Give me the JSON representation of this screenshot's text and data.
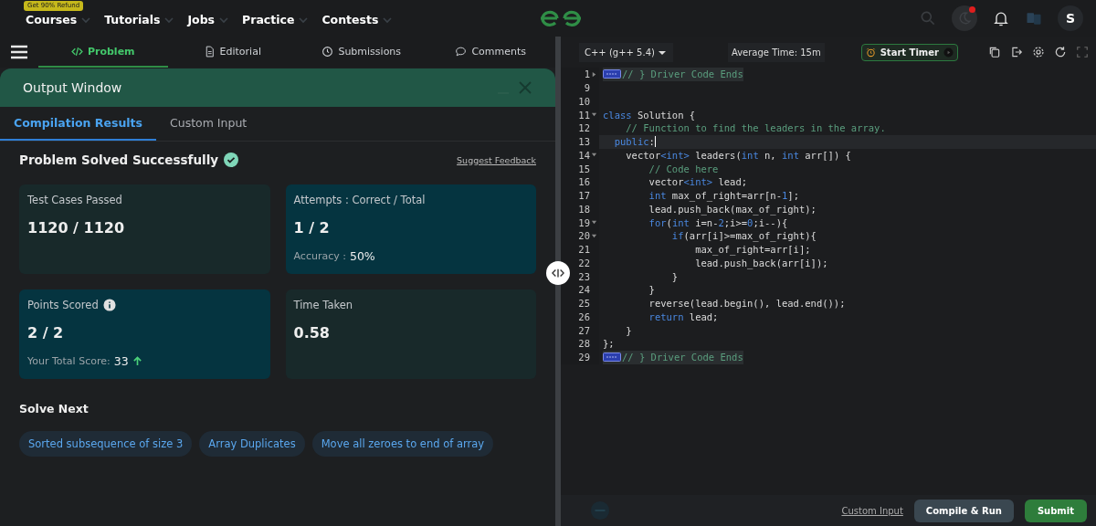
{
  "nav": {
    "badge": "Get 90% Refund",
    "items": [
      {
        "label": "Courses"
      },
      {
        "label": "Tutorials"
      },
      {
        "label": "Jobs"
      },
      {
        "label": "Practice"
      },
      {
        "label": "Contests"
      }
    ],
    "notification_dot": true,
    "avatar": "S"
  },
  "problem_tabs": [
    {
      "label": "Problem",
      "selected": true
    },
    {
      "label": "Editorial",
      "selected": false
    },
    {
      "label": "Submissions",
      "selected": false
    },
    {
      "label": "Comments",
      "selected": false
    }
  ],
  "output_window": {
    "title": "Output Window",
    "tabs": [
      {
        "label": "Compilation Results",
        "selected": true
      },
      {
        "label": "Custom Input",
        "selected": false
      }
    ],
    "status": "Problem Solved Successfully",
    "feedback_link": "Suggest Feedback",
    "cards": [
      {
        "title": "Test Cases Passed",
        "value": "1120 / 1120",
        "info": false,
        "rising": false,
        "color": "#18292a"
      },
      {
        "title": "Attempts : Correct / Total",
        "value": "1 / 2",
        "note_label": "Accuracy :",
        "note_value": "50%",
        "info": false,
        "rising": false,
        "color": "#053440"
      },
      {
        "title": "Points Scored",
        "value": "2 / 2",
        "info": true,
        "note_label": "Your Total Score:",
        "note_value": "33",
        "rising": true,
        "color": "#053440"
      },
      {
        "title": "Time Taken",
        "value": "0.58",
        "info": false,
        "rising": false,
        "color": "#18292a"
      }
    ],
    "solve_next_title": "Solve Next",
    "solve_next": [
      "Sorted subsequence of size 3",
      "Array Duplicates",
      "Move all zeroes to end of array"
    ]
  },
  "editor": {
    "language": "C++ (g++ 5.4)",
    "average_time": "Average Time: 15m",
    "timer_button": "Start Timer",
    "lines": [
      {
        "number": "1",
        "foldable": true,
        "collapsed": true,
        "badge": true,
        "current": false,
        "tokens": [
          {
            "kind": "cm",
            "text": "// } Driver Code Ends"
          }
        ]
      },
      {
        "number": "9",
        "foldable": false,
        "badge": false,
        "current": false
      },
      {
        "number": "10",
        "foldable": false,
        "badge": false,
        "current": false
      },
      {
        "number": "11",
        "foldable": true,
        "collapsed": false,
        "badge": false,
        "current": false,
        "tokens": [
          {
            "kind": "kw",
            "text": "class"
          },
          {
            "kind": "tx",
            "text": " Solution {"
          }
        ]
      },
      {
        "number": "12",
        "foldable": false,
        "badge": false,
        "current": false,
        "tokens": [
          {
            "kind": "cm",
            "text": "    // Function to find the leaders in the array."
          }
        ]
      },
      {
        "number": "13",
        "foldable": false,
        "badge": false,
        "current": true,
        "tokens": [
          {
            "kind": "kw",
            "text": "  public"
          },
          {
            "kind": "tx",
            "text": ":"
          }
        ]
      },
      {
        "number": "14",
        "foldable": true,
        "collapsed": false,
        "badge": false,
        "current": false,
        "tokens": [
          {
            "kind": "tx",
            "text": "    vector"
          },
          {
            "kind": "kw",
            "text": "<int>"
          },
          {
            "kind": "tx",
            "text": " leaders("
          },
          {
            "kind": "kw",
            "text": "int"
          },
          {
            "kind": "tx",
            "text": " n, "
          },
          {
            "kind": "kw",
            "text": "int"
          },
          {
            "kind": "tx",
            "text": " arr[]) {"
          }
        ]
      },
      {
        "number": "15",
        "foldable": false,
        "badge": false,
        "current": false,
        "tokens": [
          {
            "kind": "cm",
            "text": "        // Code here"
          }
        ]
      },
      {
        "number": "16",
        "foldable": false,
        "badge": false,
        "current": false,
        "tokens": [
          {
            "kind": "tx",
            "text": "        vector"
          },
          {
            "kind": "kw",
            "text": "<int>"
          },
          {
            "kind": "tx",
            "text": " lead;"
          }
        ]
      },
      {
        "number": "17",
        "foldable": false,
        "badge": false,
        "current": false,
        "tokens": [
          {
            "kind": "kw",
            "text": "        int"
          },
          {
            "kind": "tx",
            "text": " max_of_right=arr[n-"
          },
          {
            "kind": "num",
            "text": "1"
          },
          {
            "kind": "tx",
            "text": "];"
          }
        ]
      },
      {
        "number": "18",
        "foldable": false,
        "badge": false,
        "current": false,
        "tokens": [
          {
            "kind": "tx",
            "text": "        lead.push_back(max_of_right);"
          }
        ]
      },
      {
        "number": "19",
        "foldable": true,
        "collapsed": false,
        "badge": false,
        "current": false,
        "tokens": [
          {
            "kind": "kw",
            "text": "        for"
          },
          {
            "kind": "tx",
            "text": "("
          },
          {
            "kind": "kw",
            "text": "int"
          },
          {
            "kind": "tx",
            "text": " i=n-"
          },
          {
            "kind": "num",
            "text": "2"
          },
          {
            "kind": "tx",
            "text": ";i>="
          },
          {
            "kind": "num",
            "text": "0"
          },
          {
            "kind": "tx",
            "text": ";i--){"
          }
        ]
      },
      {
        "number": "20",
        "foldable": true,
        "collapsed": false,
        "badge": false,
        "current": false,
        "tokens": [
          {
            "kind": "kw",
            "text": "            if"
          },
          {
            "kind": "tx",
            "text": "(arr[i]>=max_of_right){"
          }
        ]
      },
      {
        "number": "21",
        "foldable": false,
        "badge": false,
        "current": false,
        "tokens": [
          {
            "kind": "tx",
            "text": "                max_of_right=arr[i];"
          }
        ]
      },
      {
        "number": "22",
        "foldable": false,
        "badge": false,
        "current": false,
        "tokens": [
          {
            "kind": "tx",
            "text": "                lead.push_back(arr[i]);"
          }
        ]
      },
      {
        "number": "23",
        "foldable": false,
        "badge": false,
        "current": false,
        "tokens": [
          {
            "kind": "tx",
            "text": "            }"
          }
        ]
      },
      {
        "number": "24",
        "foldable": false,
        "badge": false,
        "current": false,
        "tokens": [
          {
            "kind": "tx",
            "text": "        }"
          }
        ]
      },
      {
        "number": "25",
        "foldable": false,
        "badge": false,
        "current": false,
        "tokens": [
          {
            "kind": "tx",
            "text": "        reverse(lead.begin(), lead.end());"
          }
        ]
      },
      {
        "number": "26",
        "foldable": false,
        "badge": false,
        "current": false,
        "tokens": [
          {
            "kind": "kw",
            "text": "        return"
          },
          {
            "kind": "tx",
            "text": " lead;"
          }
        ]
      },
      {
        "number": "27",
        "foldable": false,
        "badge": false,
        "current": false,
        "tokens": [
          {
            "kind": "tx",
            "text": "    }"
          }
        ]
      },
      {
        "number": "28",
        "foldable": false,
        "badge": false,
        "current": false,
        "tokens": [
          {
            "kind": "tx",
            "text": "};"
          }
        ]
      },
      {
        "number": "29",
        "foldable": false,
        "badge": true,
        "current": false,
        "tokens": [
          {
            "kind": "cm",
            "text": "// } Driver Code Ends"
          }
        ]
      }
    ],
    "custom_input_link": "Custom Input",
    "compile_button": "Compile & Run",
    "submit_button": "Submit"
  }
}
